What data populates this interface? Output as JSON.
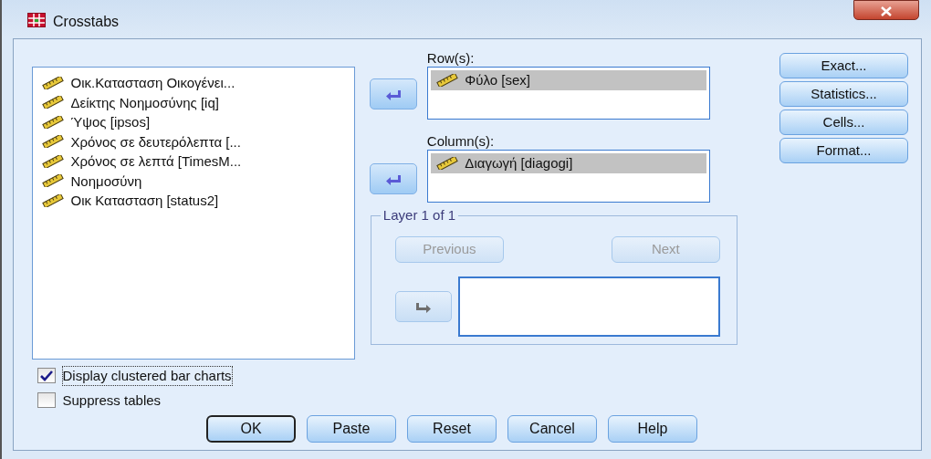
{
  "window": {
    "title": "Crosstabs"
  },
  "variables": [
    {
      "label": "Οικ.Κατασταση Οικογένει..."
    },
    {
      "label": "Δείκτης Νοημοσύνης [iq]"
    },
    {
      "label": "Ύψος [ipsos]"
    },
    {
      "label": "Χρόνος σε δευτερόλεπτα [..."
    },
    {
      "label": "Χρόνος σε λεπτά [TimesM..."
    },
    {
      "label": "Νοημοσύνη"
    },
    {
      "label": "Οικ Κατασταση [status2]"
    }
  ],
  "rows": {
    "label": "Row(s):",
    "arrow_disabled": false,
    "items": [
      {
        "label": "Φύλο [sex]",
        "selected": true
      }
    ]
  },
  "columns": {
    "label": "Column(s):",
    "arrow_disabled": false,
    "items": [
      {
        "label": "Διαγωγή [diagogi]",
        "selected": true
      }
    ]
  },
  "layer": {
    "title": "Layer 1 of 1",
    "arrow_disabled": true,
    "previous": {
      "label": "Previous",
      "disabled": true
    },
    "next": {
      "label": "Next",
      "disabled": true
    }
  },
  "side_buttons": [
    {
      "label": "Exact..."
    },
    {
      "label": "Statistics..."
    },
    {
      "label": "Cells..."
    },
    {
      "label": "Format..."
    }
  ],
  "options": [
    {
      "label": "Display clustered bar charts",
      "checked": true
    },
    {
      "label": "Suppress tables",
      "checked": false
    }
  ],
  "buttons": [
    {
      "label": "OK",
      "default": true
    },
    {
      "label": "Paste",
      "default": false
    },
    {
      "label": "Reset",
      "default": false
    },
    {
      "label": "Cancel",
      "default": false
    },
    {
      "label": "Help",
      "default": false
    }
  ]
}
